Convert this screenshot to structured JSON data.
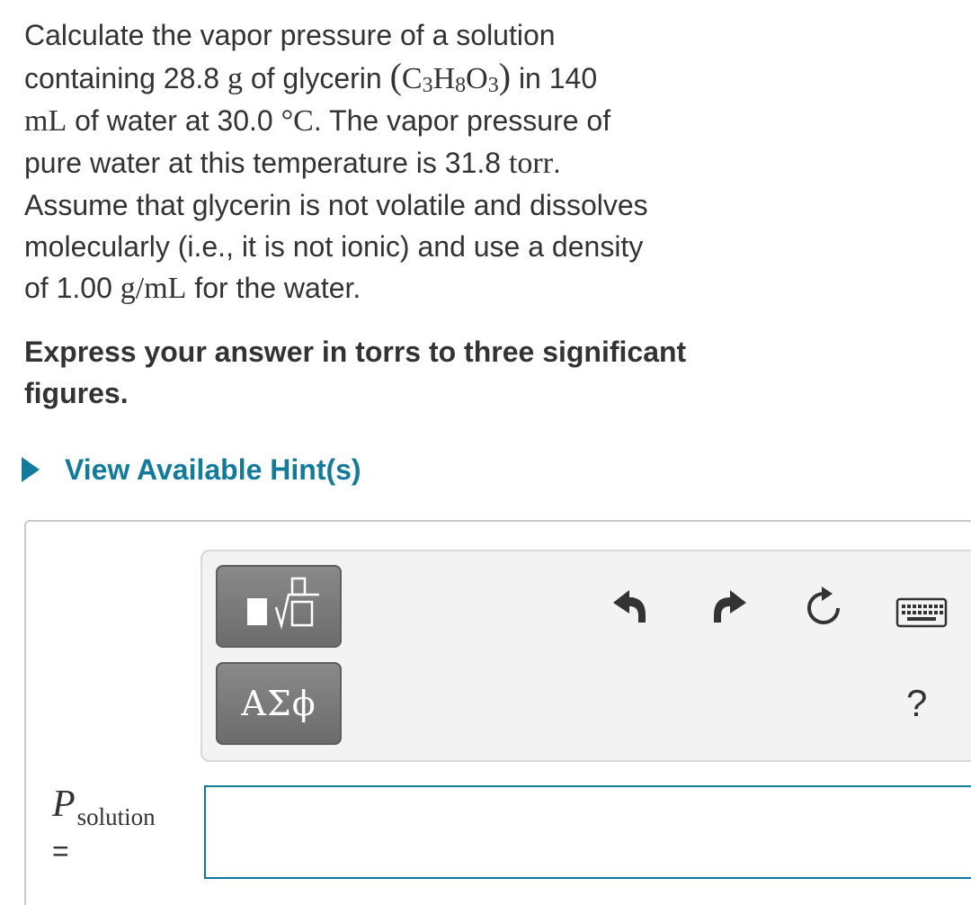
{
  "problem": {
    "line1": "Calculate the vapor pressure of a solution",
    "line2_prefix": "containing 28.8",
    "unit_g": "g",
    "line2_mid": "of glycerin",
    "formula_c": "C",
    "formula_c_sub": "3",
    "formula_h": "H",
    "formula_h_sub": "8",
    "formula_o": "O",
    "formula_o_sub": "3",
    "line2_suffix": "in 140",
    "unit_ml": "mL",
    "line3_mid": "of water at 30.0",
    "degree_unit": "°C",
    "line3_suffix": ". The vapor pressure of",
    "line4_prefix": "pure water at this temperature is 31.8",
    "unit_torr": "torr",
    "line4_suffix": ".",
    "line5": "Assume that glycerin is not volatile and dissolves",
    "line6": "molecularly (i.e., it is not ionic) and use a density",
    "line7_prefix": "of 1.00",
    "unit_density": "g/mL",
    "line7_suffix": "for the water."
  },
  "instruction": "Express your answer in torrs to three significant figures.",
  "hint_label": "View Available Hint(s)",
  "toolbar": {
    "symbols_label": "ΑΣϕ",
    "help_label": "?"
  },
  "answer": {
    "variable": "P",
    "subscript": "solution",
    "equals": "=",
    "value": ""
  },
  "colors": {
    "link": "#137a9b",
    "input_border": "#137a9b",
    "tool_button": "#757575"
  }
}
